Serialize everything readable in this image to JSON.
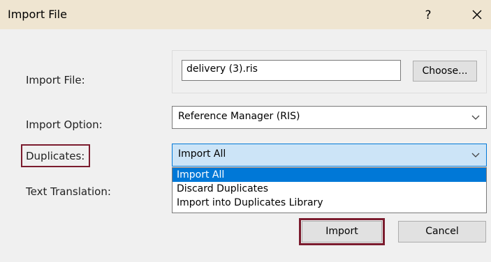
{
  "window": {
    "title": "Import File",
    "help_label": "?",
    "close_icon": "close-icon"
  },
  "form": {
    "import_file": {
      "label": "Import File:",
      "value": "delivery (3).ris",
      "choose_label": "Choose..."
    },
    "import_option": {
      "label": "Import Option:",
      "value": "Reference Manager (RIS)"
    },
    "duplicates": {
      "label": "Duplicates:",
      "value": "Import All",
      "options": [
        "Import All",
        "Discard Duplicates",
        "Import into Duplicates Library"
      ],
      "selected_index": 0
    },
    "text_translation": {
      "label": "Text Translation:"
    }
  },
  "buttons": {
    "import_label": "Import",
    "cancel_label": "Cancel"
  },
  "colors": {
    "titlebar": "#efe5d1",
    "highlight_outline": "#7b1c2e",
    "selection": "#0078d7",
    "focused_select": "#cce4f7"
  }
}
